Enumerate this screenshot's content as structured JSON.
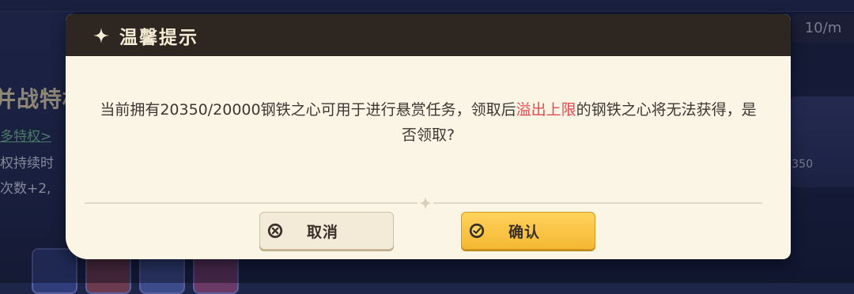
{
  "background": {
    "counter": "10/m",
    "left_title": "并战特权",
    "left_link": "多特权>",
    "left_line1": "权持续时",
    "left_line2": "次数+2,",
    "right_num": "350"
  },
  "dialog": {
    "title": "温馨提示",
    "message_part1": "当前拥有20350/20000钢铁之心可用于进行悬赏任务，领取后",
    "message_highlight": "溢出上限",
    "message_part2": "的钢铁之心将无法获得，是否领取?",
    "cancel_label": "取消",
    "confirm_label": "确认"
  },
  "colors": {
    "header_bg": "#2e2620",
    "dialog_bg": "#fbf5e6",
    "highlight": "#e5494c",
    "confirm_bg": "#f5b733"
  },
  "icons": {
    "title": "sparkle-icon",
    "cancel": "close-circle-icon",
    "confirm": "check-circle-icon"
  }
}
